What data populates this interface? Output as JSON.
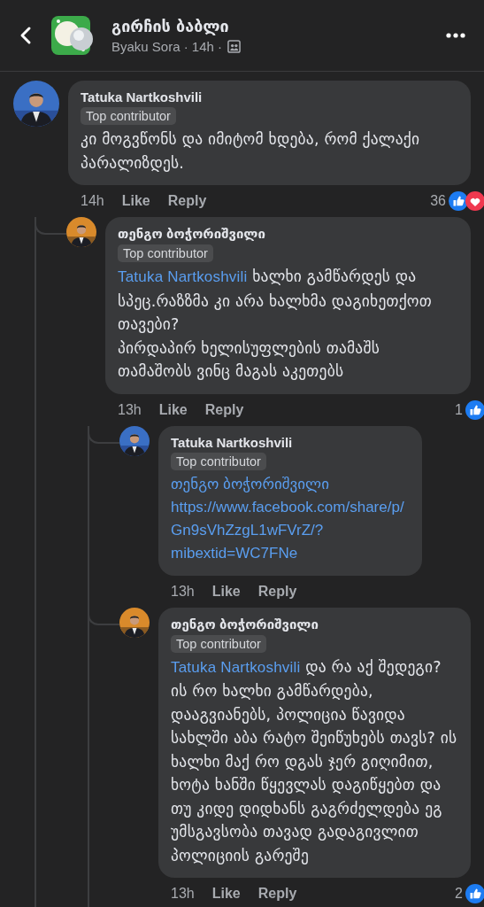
{
  "header": {
    "title": "გირჩის ბაბლი",
    "subtitle": "Byaku Sora · 14h ·"
  },
  "comments": [
    {
      "author": "Tatuka Nartkoshvili",
      "badge": "Top contributor",
      "text": "კი მოგვწონს და იმიტომ ხდება, რომ ქალაქი პარალიზდეს.",
      "time": "14h",
      "like": "Like",
      "reply": "Reply",
      "count": "36",
      "reactions": [
        {
          "kind": "like"
        },
        {
          "kind": "love"
        }
      ],
      "children": [
        {
          "author": "თენგო ბოჭორიშვილი",
          "badge": "Top contributor",
          "mention": "Tatuka Nartkoshvili",
          "text": "ხალხი გამწარდეს და სპეც.რაზზმა კი არა ხალხმა დაგიხეთქოთ თავები?\nპირდაპირ ხელისუფლების თამაშს თამაშობს ვინც მაგას აკეთებს",
          "time": "13h",
          "like": "Like",
          "reply": "Reply",
          "count": "1",
          "reactions": [
            {
              "kind": "like"
            }
          ],
          "children": [
            {
              "author": "Tatuka Nartkoshvili",
              "badge": "Top contributor",
              "mention": "თენგო ბოჭორიშვილი",
              "link": "https://www.facebook.com/share/p/Gn9sVhZzgL1wFVrZ/?mibextid=WC7FNe",
              "time": "13h",
              "like": "Like",
              "reply": "Reply"
            },
            {
              "author": "თენგო ბოჭორიშვილი",
              "badge": "Top contributor",
              "mention": "Tatuka Nartkoshvili",
              "text": "და რა აქ შედეგი? ის რო ხალხი გამწარდება, დააგვიანებს, პოლიცია წავიდა სახლში აბა რატო შეიწუხებს თავს? ის ხალხი მაქ რო დგას ჯერ გიღიმით, ხოტა ხანში წყევლას დაგიწყებთ და თუ კიდე დიდხანს გაგრძელდება ეგ უმსგავსობა თავად გადაგივლით პოლიციის გარეშე",
              "time": "13h",
              "like": "Like",
              "reply": "Reply",
              "count": "2",
              "reactions": [
                {
                  "kind": "like"
                }
              ]
            }
          ]
        }
      ]
    }
  ]
}
